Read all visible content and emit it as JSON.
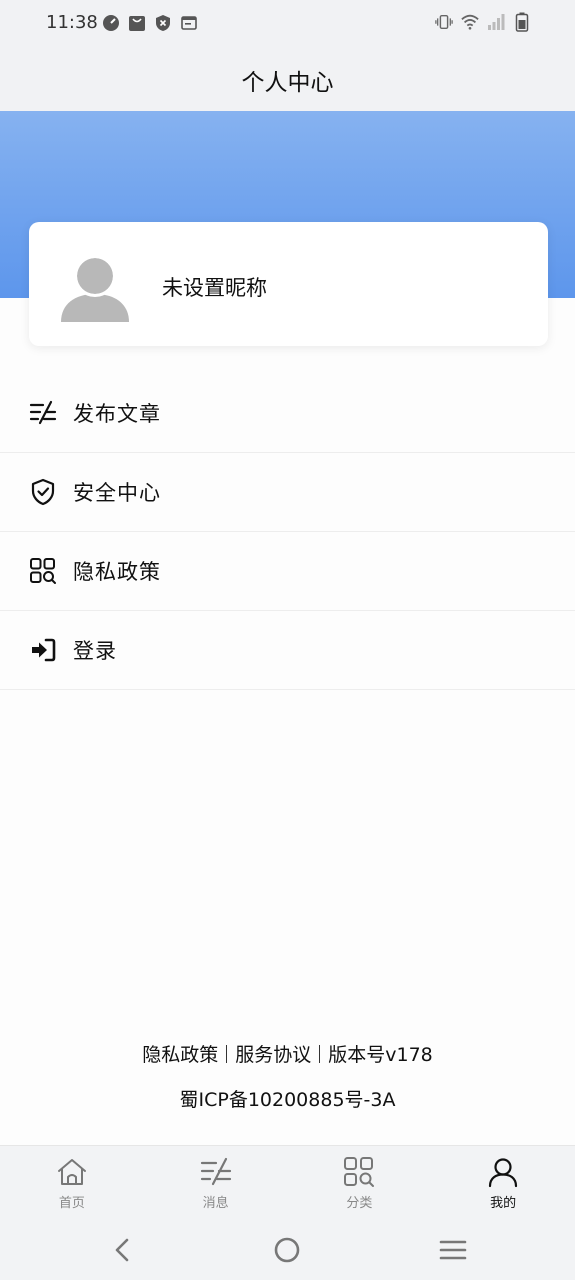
{
  "status_bar": {
    "time": "11:38",
    "left_icons": [
      "speedometer-icon",
      "shopping-bag-icon",
      "shield-x-icon",
      "window-icon"
    ],
    "right_icons": [
      "vibrate-icon",
      "wifi-icon",
      "signal-icon",
      "battery-icon"
    ]
  },
  "header": {
    "title": "个人中心"
  },
  "banner": {
    "gradient_top": "#86b2f0",
    "gradient_bottom": "#5d96ec"
  },
  "profile": {
    "nickname": "未设置昵称"
  },
  "menu": {
    "items": [
      {
        "label": "发布文章",
        "icon": "edit-lines-icon"
      },
      {
        "label": "安全中心",
        "icon": "shield-check-icon"
      },
      {
        "label": "隐私政策",
        "icon": "grid-search-icon"
      },
      {
        "label": "登录",
        "icon": "login-arrow-icon"
      }
    ]
  },
  "footer": {
    "links": [
      "隐私政策",
      "服务协议",
      "版本号v178"
    ],
    "icp": "蜀ICP备10200885号-3A"
  },
  "tabbar": {
    "items": [
      {
        "label": "首页",
        "icon": "home-icon",
        "active": false
      },
      {
        "label": "消息",
        "icon": "edit-lines-icon",
        "active": false
      },
      {
        "label": "分类",
        "icon": "grid-search-icon",
        "active": false
      },
      {
        "label": "我的",
        "icon": "user-icon",
        "active": true
      }
    ]
  },
  "nav": {
    "buttons": [
      "back-icon",
      "home-circle-icon",
      "menu-lines-icon"
    ]
  }
}
